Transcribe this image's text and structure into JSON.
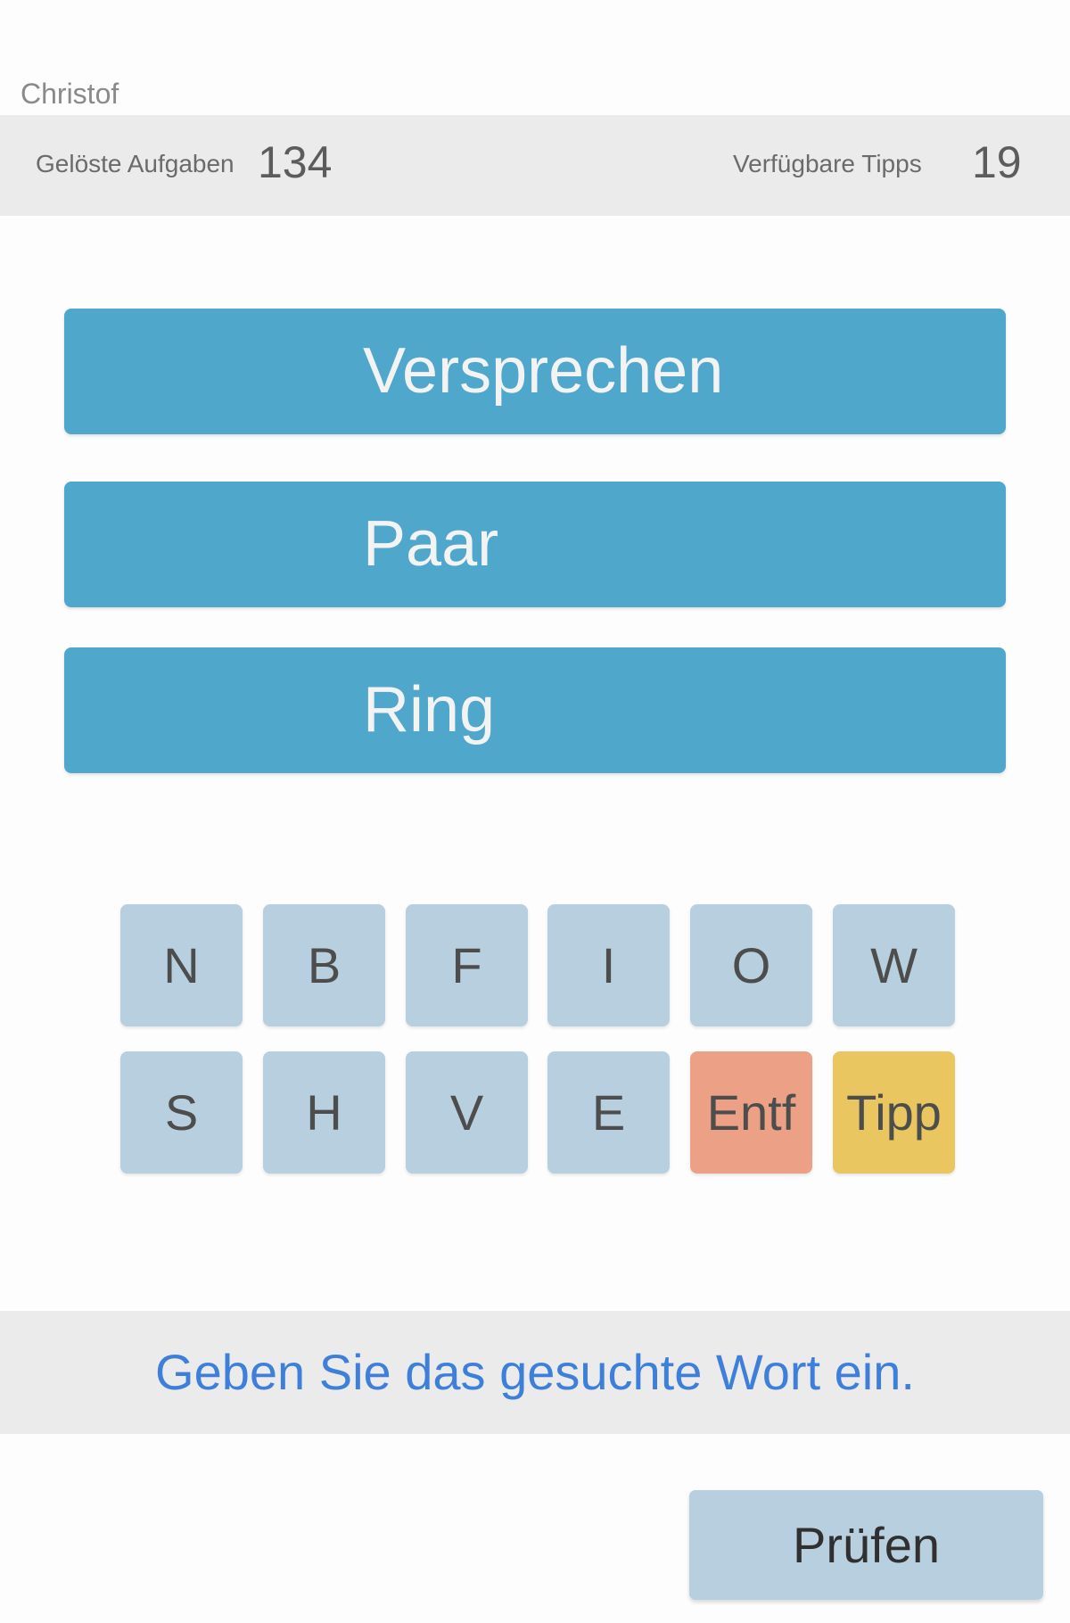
{
  "user": {
    "name": "Christof"
  },
  "stats": {
    "solved_label": "Gelöste Aufgaben",
    "solved_value": "134",
    "tips_label": "Verfügbare Tipps",
    "tips_value": "19"
  },
  "clues": [
    "Versprechen",
    "Paar",
    "Ring"
  ],
  "keyboard": {
    "rows": [
      [
        "N",
        "B",
        "F",
        "I",
        "O",
        "W"
      ],
      [
        "S",
        "H",
        "V",
        "E",
        "Entf",
        "Tipp"
      ]
    ]
  },
  "message": "Geben Sie das gesuchte Wort ein.",
  "check_button_label": "Prüfen",
  "colors": {
    "clue_background": "#4fa7cb",
    "letter_key": "#b7cfdf",
    "delete_key": "#eca186",
    "hint_key": "#e9c660",
    "message_text": "#3d7fd9"
  }
}
